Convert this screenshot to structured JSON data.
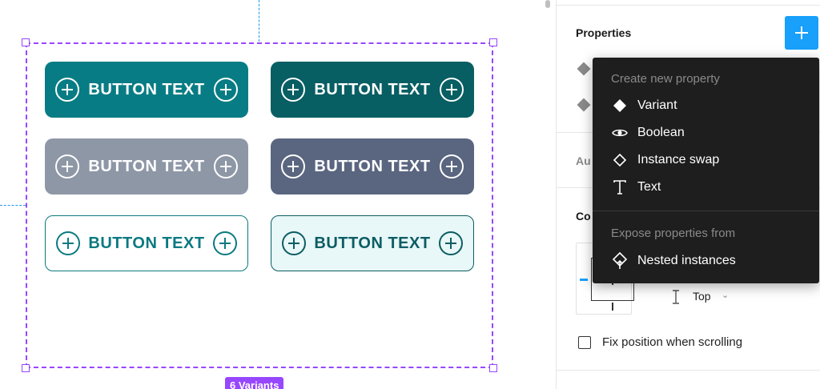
{
  "canvas": {
    "variants_badge": "6 Variants",
    "buttons": [
      {
        "label": "BUTTON TEXT",
        "bg": "#087c84",
        "fg": "#ffffff",
        "border": "none"
      },
      {
        "label": "BUTTON TEXT",
        "bg": "#075e63",
        "fg": "#ffffff",
        "border": "none"
      },
      {
        "label": "BUTTON TEXT",
        "bg": "#8e97a6",
        "fg": "#ffffff",
        "border": "none"
      },
      {
        "label": "BUTTON TEXT",
        "bg": "#5a6680",
        "fg": "#ffffff",
        "border": "none"
      },
      {
        "label": "BUTTON TEXT",
        "bg": "#ffffff",
        "fg": "#0b7a80",
        "border": "#0b7a80"
      },
      {
        "label": "BUTTON TEXT",
        "bg": "#e8f7f7",
        "fg": "#0c5d64",
        "border": "#0c5d64"
      }
    ]
  },
  "panel": {
    "properties_title": "Properties",
    "add_icon": "plus-icon",
    "section_partial_1": "Au",
    "section_partial_2": "Co",
    "vertical_constraint": "Top",
    "fix_position_label": "Fix position when scrolling",
    "fix_position_checked": false
  },
  "menu": {
    "header_create": "Create new property",
    "items": [
      {
        "label": "Variant",
        "icon": "diamond-filled-icon"
      },
      {
        "label": "Boolean",
        "icon": "eye-icon"
      },
      {
        "label": "Instance swap",
        "icon": "diamond-outline-icon"
      },
      {
        "label": "Text",
        "icon": "text-icon"
      }
    ],
    "header_expose": "Expose properties from",
    "nested": {
      "label": "Nested instances",
      "icon": "nested-instance-icon"
    }
  },
  "colors": {
    "accent_blue": "#18a0fb",
    "selection_purple": "#9747ff",
    "menu_bg": "#1e1e1e"
  }
}
